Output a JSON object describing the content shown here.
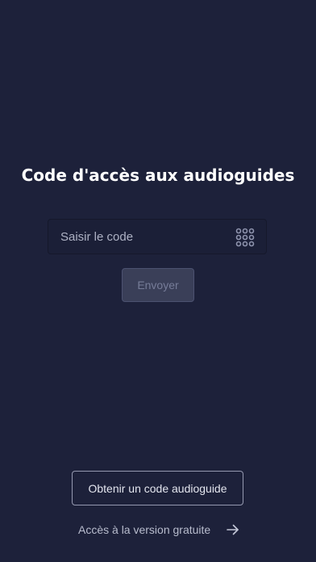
{
  "screen": {
    "title": "Code d'accès aux audioguides"
  },
  "code_form": {
    "input_placeholder": "Saisir le code",
    "input_value": "",
    "keypad_icon": "keypad-icon",
    "send_label": "Envoyer"
  },
  "footer": {
    "obtain_code_label": "Obtenir un code audioguide",
    "free_version_label": "Accès à la version gratuite",
    "arrow_icon": "arrow-right-icon"
  },
  "colors": {
    "background": "#1d213a",
    "input_background": "#1b1f37",
    "disabled_button": "#3a3f58",
    "text_primary": "#ffffff"
  }
}
